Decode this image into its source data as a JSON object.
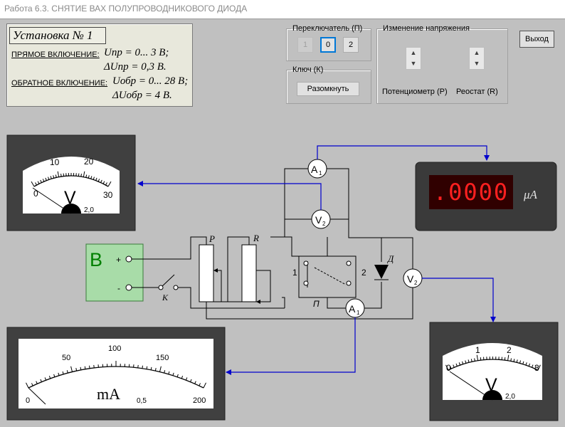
{
  "window": {
    "title": "Работа 6.3. СНЯТИЕ ВАХ ПОЛУПРОВОДНИКОВОГО ДИОДА"
  },
  "setup": {
    "title": "Установка № 1",
    "forward_label": "ПРЯМОЕ ВКЛЮЧЕНИЕ:",
    "forward_range": "Uпр = 0... 3 В;",
    "forward_delta": "ΔUпр = 0,3 В.",
    "reverse_label": "ОБРАТНОЕ ВКЛЮЧЕНИЕ:",
    "reverse_range": "Uобр = 0... 28 В;",
    "reverse_delta": "ΔUобр = 4 В."
  },
  "switch_group": {
    "legend": "Переключатель (П)",
    "options": [
      "1",
      "0",
      "2"
    ],
    "selected": "0"
  },
  "key_group": {
    "legend": "Ключ (К)",
    "button": "Разомкнуть"
  },
  "voltage_group": {
    "legend": "Изменение напряжения",
    "pot_label": "Потенциометр (Р)",
    "rheo_label": "Реостат (R)",
    "spin_up": "▲",
    "spin_down": "▼"
  },
  "exit_button": "Выход",
  "meters": {
    "voltmeter_top": {
      "ticks": [
        "0",
        "10",
        "20",
        "30"
      ],
      "unit": "V",
      "class": "2,0",
      "value": 0
    },
    "microammeter": {
      "display": ".0000",
      "unit": "μA"
    },
    "milliammeter": {
      "ticks": [
        "0",
        "50",
        "100",
        "150",
        "200"
      ],
      "unit": "mA",
      "class": "0,5",
      "value": 0
    },
    "voltmeter_bottom": {
      "ticks": [
        "0",
        "1",
        "2",
        "3"
      ],
      "unit": "V",
      "class": "2,0",
      "value": 0
    }
  },
  "circuit": {
    "source": "B",
    "plus": "+",
    "minus": "-",
    "key": "K",
    "pot": "P",
    "rheostat": "R",
    "switch_label": "П",
    "pos1": "1",
    "pos2": "2",
    "diode": "Д",
    "a_sym": "A",
    "a_sub": "1",
    "v_sym": "V",
    "v_sub": "2"
  },
  "colors": {
    "wire": "#000000",
    "probe": "#0000cc",
    "source_fill": "#a8dca8",
    "source_text": "#008000",
    "display_bg": "#300000",
    "display_text": "#ff2020"
  }
}
